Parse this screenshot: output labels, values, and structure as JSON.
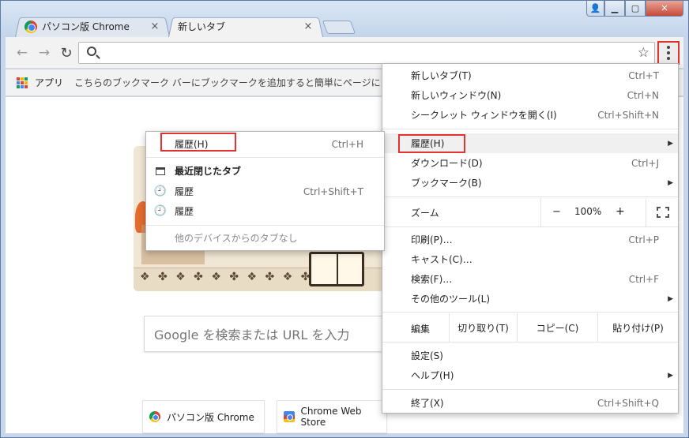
{
  "window": {
    "tabs": [
      {
        "label": "パソコン版 Chrome",
        "close": "×"
      },
      {
        "label": "新しいタブ",
        "close": "×"
      }
    ],
    "controls": {
      "user": "👤",
      "minimize": "▁",
      "maximize": "▢",
      "close": "✕"
    }
  },
  "toolbar": {
    "back": "←",
    "forward": "→",
    "reload": "↻",
    "address_value": "",
    "star": "☆"
  },
  "bookmarks": {
    "apps_label": "アプリ",
    "hint": "こちらのブックマーク バーにブックマークを追加すると簡単にページにアクセスできます。",
    "apps_colors": [
      "#db4437",
      "#f4b400",
      "#0f9d58",
      "#4285f4",
      "#db4437",
      "#f4b400",
      "#0f9d58",
      "#4285f4",
      "#db4437"
    ]
  },
  "page": {
    "search_placeholder": "Google を検索または URL を入力",
    "doodle_ornament": "❖ ✤ ❖ ✤ ❖ ✤ ❖ ✤ ❖ ✤ ❖",
    "tiles": [
      {
        "label": "パソコン版 Chrome"
      },
      {
        "label": "Chrome Web Store"
      }
    ]
  },
  "history_submenu": {
    "header": {
      "label": "履歴(H)",
      "shortcut": "Ctrl+H"
    },
    "recently_closed": "最近閉じたタブ",
    "items": [
      {
        "label": "履歴",
        "shortcut": "Ctrl+Shift+T"
      },
      {
        "label": "履歴",
        "shortcut": ""
      }
    ],
    "no_other_devices": "他のデバイスからのタブなし"
  },
  "menu": {
    "new_tab": {
      "label": "新しいタブ(T)",
      "shortcut": "Ctrl+T"
    },
    "new_window": {
      "label": "新しいウィンドウ(N)",
      "shortcut": "Ctrl+N"
    },
    "incognito": {
      "label": "シークレット ウィンドウを開く(I)",
      "shortcut": "Ctrl+Shift+N"
    },
    "history": {
      "label": "履歴(H)",
      "arrow": "▶"
    },
    "downloads": {
      "label": "ダウンロード(D)",
      "shortcut": "Ctrl+J"
    },
    "bookmarks": {
      "label": "ブックマーク(B)",
      "arrow": "▶"
    },
    "zoom": {
      "label": "ズーム",
      "minus": "−",
      "value": "100%",
      "plus": "+"
    },
    "print": {
      "label": "印刷(P)…",
      "shortcut": "Ctrl+P"
    },
    "cast": {
      "label": "キャスト(C)…"
    },
    "find": {
      "label": "検索(F)…",
      "shortcut": "Ctrl+F"
    },
    "more_tools": {
      "label": "その他のツール(L)",
      "arrow": "▶"
    },
    "edit": {
      "label": "編集",
      "cut": "切り取り(T)",
      "copy": "コピー(C)",
      "paste": "貼り付け(P)"
    },
    "settings": {
      "label": "設定(S)"
    },
    "help": {
      "label": "ヘルプ(H)",
      "arrow": "▶"
    },
    "exit": {
      "label": "終了(X)",
      "shortcut": "Ctrl+Shift+Q"
    }
  },
  "colors": {
    "highlight": "#e0322f",
    "frame": "#c7d6ea"
  }
}
